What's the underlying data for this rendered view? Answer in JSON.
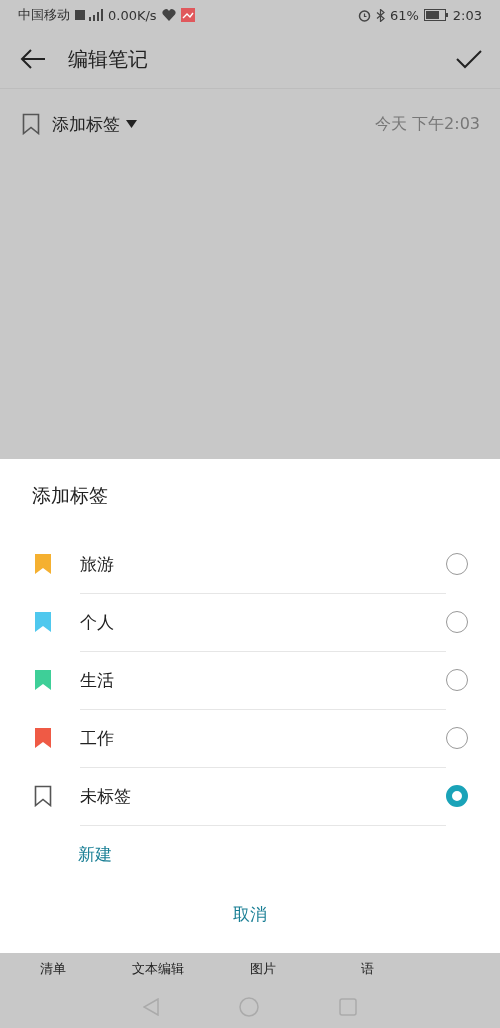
{
  "status_bar": {
    "carrier": "中国移动",
    "speed": "0.00K/s",
    "battery": "61%",
    "time": "2:03"
  },
  "header": {
    "title": "编辑笔记"
  },
  "tag_row": {
    "label": "添加标签",
    "date": "今天 下午2:03"
  },
  "sheet": {
    "title": "添加标签",
    "options": [
      {
        "label": "旅游",
        "kind": "filled",
        "color": "#f5b030",
        "selected": false
      },
      {
        "label": "个人",
        "kind": "filled",
        "color": "#4fc8ee",
        "selected": false
      },
      {
        "label": "生活",
        "kind": "filled",
        "color": "#3ecf98",
        "selected": false
      },
      {
        "label": "工作",
        "kind": "filled",
        "color": "#ef5a45",
        "selected": false
      },
      {
        "label": "未标签",
        "kind": "outline",
        "selected": true
      }
    ],
    "new_label": "新建",
    "cancel": "取消"
  },
  "toolbar": [
    "清单",
    "文本编辑",
    "图片",
    "语"
  ]
}
